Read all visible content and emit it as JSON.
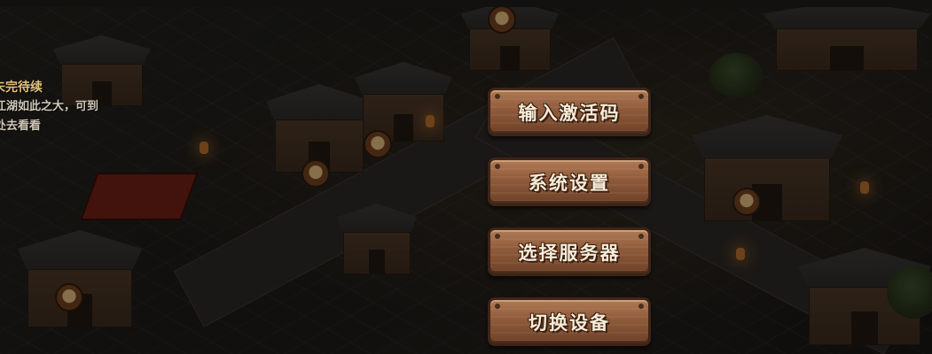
{
  "quest_note": {
    "title": "未完待续",
    "line1": "江湖如此之大，可到",
    "line2": "处去看看"
  },
  "menu": {
    "items": [
      {
        "label": "输入激活码",
        "name": "enter-activation-code-button"
      },
      {
        "label": "系统设置",
        "name": "system-settings-button"
      },
      {
        "label": "选择服务器",
        "name": "select-server-button"
      },
      {
        "label": "切换设备",
        "name": "switch-device-button"
      }
    ]
  },
  "colors": {
    "button_wood": "#8e5a3a",
    "button_text": "#f7ecd8",
    "quest_title": "#e2c27a",
    "quest_text": "#cfc6b6"
  }
}
